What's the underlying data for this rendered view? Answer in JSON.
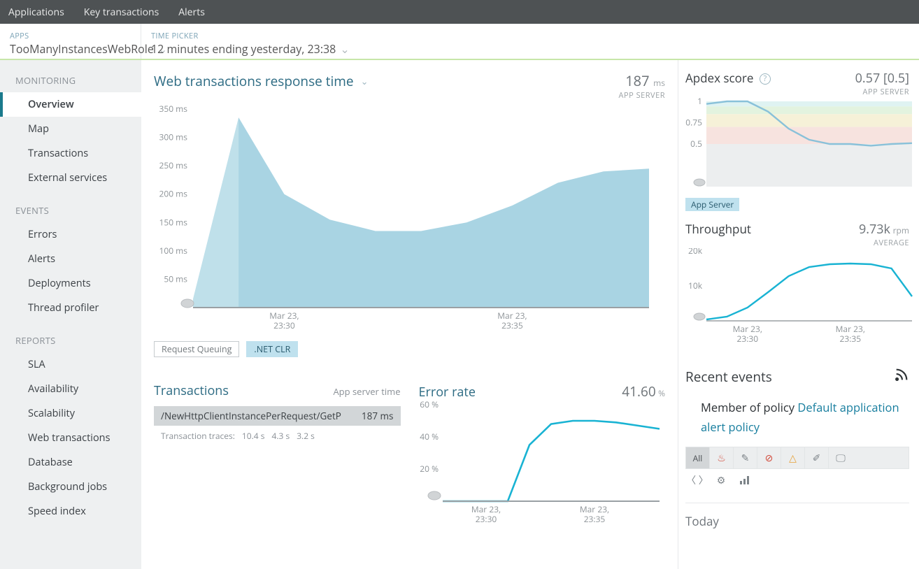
{
  "topnav": [
    "Applications",
    "Key transactions",
    "Alerts"
  ],
  "subheader": {
    "apps_label": "APPS",
    "apps_value": "TooManyInstancesWebRole",
    "tp_label": "TIME PICKER",
    "tp_value": "12 minutes ending yesterday, 23:38"
  },
  "sidebar": {
    "groups": [
      {
        "title": "MONITORING",
        "items": [
          "Overview",
          "Map",
          "Transactions",
          "External services"
        ]
      },
      {
        "title": "EVENTS",
        "items": [
          "Errors",
          "Alerts",
          "Deployments",
          "Thread profiler"
        ]
      },
      {
        "title": "REPORTS",
        "items": [
          "SLA",
          "Availability",
          "Scalability",
          "Web transactions",
          "Database",
          "Background jobs",
          "Speed index"
        ]
      }
    ],
    "active": "Overview"
  },
  "response_panel": {
    "title": "Web transactions response time",
    "value": "187",
    "unit": "ms",
    "sub": "APP SERVER",
    "legend": {
      "inactive": "Request Queuing",
      "active": ".NET CLR"
    }
  },
  "apdex": {
    "title": "Apdex score",
    "value": "0.57 [0.5]",
    "sub": "APP SERVER",
    "chip": "App Server"
  },
  "throughput": {
    "title": "Throughput",
    "value": "9.73k",
    "unit": "rpm",
    "sub": "AVERAGE"
  },
  "transactions": {
    "title": "Transactions",
    "sub": "App server time",
    "row_name": "/NewHttpClientInstancePerRequest/GetP",
    "row_val": "187 ms",
    "trace_label": "Transaction traces:",
    "traces": [
      "10.4 s",
      "4.3 s",
      "3.2 s"
    ]
  },
  "error": {
    "title": "Error rate",
    "value": "41.60",
    "unit": "%"
  },
  "events": {
    "title": "Recent events",
    "policy_prefix": "Member of policy ",
    "policy_link": "Default application alert policy",
    "all": "All",
    "today": "Today"
  },
  "x_ticks": [
    "Mar 23,",
    "23:30",
    "Mar 23,",
    "23:35"
  ],
  "chart_data": [
    {
      "type": "area",
      "title": "Web transactions response time",
      "ylabel": "ms",
      "ylim": [
        0,
        350
      ],
      "y_ticks": [
        50,
        100,
        150,
        200,
        250,
        300,
        350
      ],
      "x": [
        "23:28",
        "23:29",
        "23:30",
        "23:31",
        "23:32",
        "23:33",
        "23:34",
        "23:35",
        "23:36",
        "23:37",
        "23:38"
      ],
      "series": [
        {
          "name": ".NET CLR",
          "values": [
            15,
            335,
            200,
            155,
            135,
            135,
            150,
            180,
            220,
            240,
            245
          ]
        }
      ],
      "x_tick_labels": [
        "Mar 23, 23:30",
        "Mar 23, 23:35"
      ]
    },
    {
      "type": "line",
      "title": "Apdex score",
      "ylim": [
        0,
        1
      ],
      "y_ticks": [
        0.5,
        0.75,
        1
      ],
      "x": [
        "23:28",
        "23:29",
        "23:30",
        "23:31",
        "23:32",
        "23:33",
        "23:34",
        "23:35",
        "23:36",
        "23:37",
        "23:38"
      ],
      "series": [
        {
          "name": "App Server",
          "values": [
            0.97,
            1.0,
            1.0,
            0.88,
            0.68,
            0.55,
            0.5,
            0.5,
            0.48,
            0.5,
            0.51
          ]
        }
      ],
      "bands": [
        {
          "from": 0.94,
          "to": 1.0,
          "color": "#dff3f2"
        },
        {
          "from": 0.85,
          "to": 0.94,
          "color": "#e3f3df"
        },
        {
          "from": 0.7,
          "to": 0.85,
          "color": "#f6f1d8"
        },
        {
          "from": 0.5,
          "to": 0.7,
          "color": "#f7e3df"
        },
        {
          "from": 0.0,
          "to": 0.5,
          "color": "#eceeef"
        }
      ]
    },
    {
      "type": "line",
      "title": "Throughput",
      "ylabel": "rpm",
      "ylim": [
        0,
        20000
      ],
      "y_ticks": [
        10000,
        20000
      ],
      "y_tick_labels": [
        "10k",
        "20k"
      ],
      "x": [
        "23:28",
        "23:29",
        "23:30",
        "23:31",
        "23:32",
        "23:33",
        "23:34",
        "23:35",
        "23:36",
        "23:37",
        "23:38"
      ],
      "series": [
        {
          "name": "Throughput",
          "values": [
            400,
            1200,
            3800,
            8200,
            12800,
            15400,
            16200,
            16400,
            16200,
            15000,
            7000
          ]
        }
      ],
      "x_tick_labels": [
        "Mar 23, 23:30",
        "Mar 23, 23:35"
      ]
    },
    {
      "type": "line",
      "title": "Error rate",
      "ylabel": "%",
      "ylim": [
        0,
        60
      ],
      "y_ticks": [
        20,
        40,
        60
      ],
      "x": [
        "23:28",
        "23:29",
        "23:30",
        "23:31",
        "23:32",
        "23:33",
        "23:34",
        "23:35",
        "23:36",
        "23:37",
        "23:38"
      ],
      "series": [
        {
          "name": "Error rate",
          "values": [
            0,
            0,
            0,
            0,
            35,
            48,
            50,
            50,
            49,
            47,
            45
          ]
        }
      ],
      "x_tick_labels": [
        "Mar 23, 23:30",
        "Mar 23, 23:35"
      ]
    }
  ]
}
